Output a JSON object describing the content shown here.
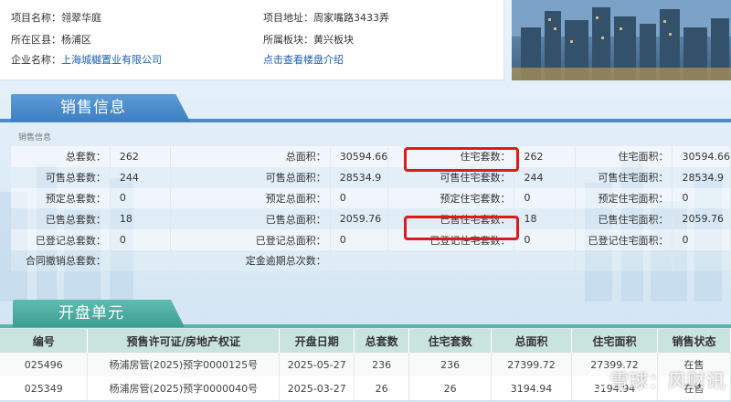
{
  "project": {
    "rows": [
      {
        "label": "项目名称：",
        "value": "翎翠华庭",
        "link": false
      },
      {
        "label": "所在区县：",
        "value": "杨浦区",
        "link": false
      },
      {
        "label": "企业名称：",
        "value": "上海城樾置业有限公司",
        "link": true
      }
    ],
    "rows_right": [
      {
        "label": "项目地址：",
        "value": "周家嘴路3433弄",
        "link": false
      },
      {
        "label": "所属板块：",
        "value": "黄兴板块",
        "link": false
      },
      {
        "label": "",
        "value": "点击查看楼盘介绍",
        "link": true
      }
    ]
  },
  "sales_section": {
    "title": "销售信息",
    "subtitle": "销售信息",
    "rows": [
      [
        {
          "l": "总套数：",
          "v": "262"
        },
        {
          "l": "总面积：",
          "v": "30594.66"
        },
        {
          "l": "住宅套数：",
          "v": "262"
        },
        {
          "l": "住宅面积：",
          "v": "30594.66"
        }
      ],
      [
        {
          "l": "可售总套数：",
          "v": "244"
        },
        {
          "l": "可售总面积：",
          "v": "28534.9"
        },
        {
          "l": "可售住宅套数：",
          "v": "244"
        },
        {
          "l": "可售住宅面积：",
          "v": "28534.9"
        }
      ],
      [
        {
          "l": "预定总套数：",
          "v": "0"
        },
        {
          "l": "预定总面积：",
          "v": "0"
        },
        {
          "l": "预定住宅套数：",
          "v": "0"
        },
        {
          "l": "预定住宅面积：",
          "v": "0"
        }
      ],
      [
        {
          "l": "已售总套数：",
          "v": "18"
        },
        {
          "l": "已售总面积：",
          "v": "2059.76"
        },
        {
          "l": "已售住宅套数：",
          "v": "18"
        },
        {
          "l": "已售住宅面积：",
          "v": "2059.76"
        }
      ],
      [
        {
          "l": "已登记总套数：",
          "v": "0"
        },
        {
          "l": "已登记总面积：",
          "v": "0"
        },
        {
          "l": "已登记住宅套数：",
          "v": "0"
        },
        {
          "l": "已登记住宅面积：",
          "v": "0"
        }
      ],
      [
        {
          "l": "合同撤销总套数：",
          "v": ""
        },
        {
          "l": "定金逾期总次数：",
          "v": ""
        },
        {
          "l": "",
          "v": ""
        },
        {
          "l": "",
          "v": ""
        }
      ]
    ]
  },
  "units_section": {
    "title": "开盘单元",
    "headers": [
      "编号",
      "预售许可证/房地产权证",
      "开盘日期",
      "总套数",
      "住宅套数",
      "总面积",
      "住宅面积",
      "销售状态"
    ],
    "rows": [
      [
        "025496",
        "杨浦房管(2025)预字0000125号",
        "2025-05-27",
        "236",
        "236",
        "27399.72",
        "27399.72",
        "在售"
      ],
      [
        "025349",
        "杨浦房管(2025)预字0000040号",
        "2025-03-27",
        "26",
        "26",
        "3194.94",
        "3194.94",
        "在售"
      ]
    ]
  },
  "watermark": "雪球：风财讯",
  "colors": {
    "highlight": "#e0191b",
    "section_blue": "#3e7fc2",
    "section_green": "#3d9d92",
    "link": "#1a5fb4",
    "status": "#1e8a2e"
  }
}
